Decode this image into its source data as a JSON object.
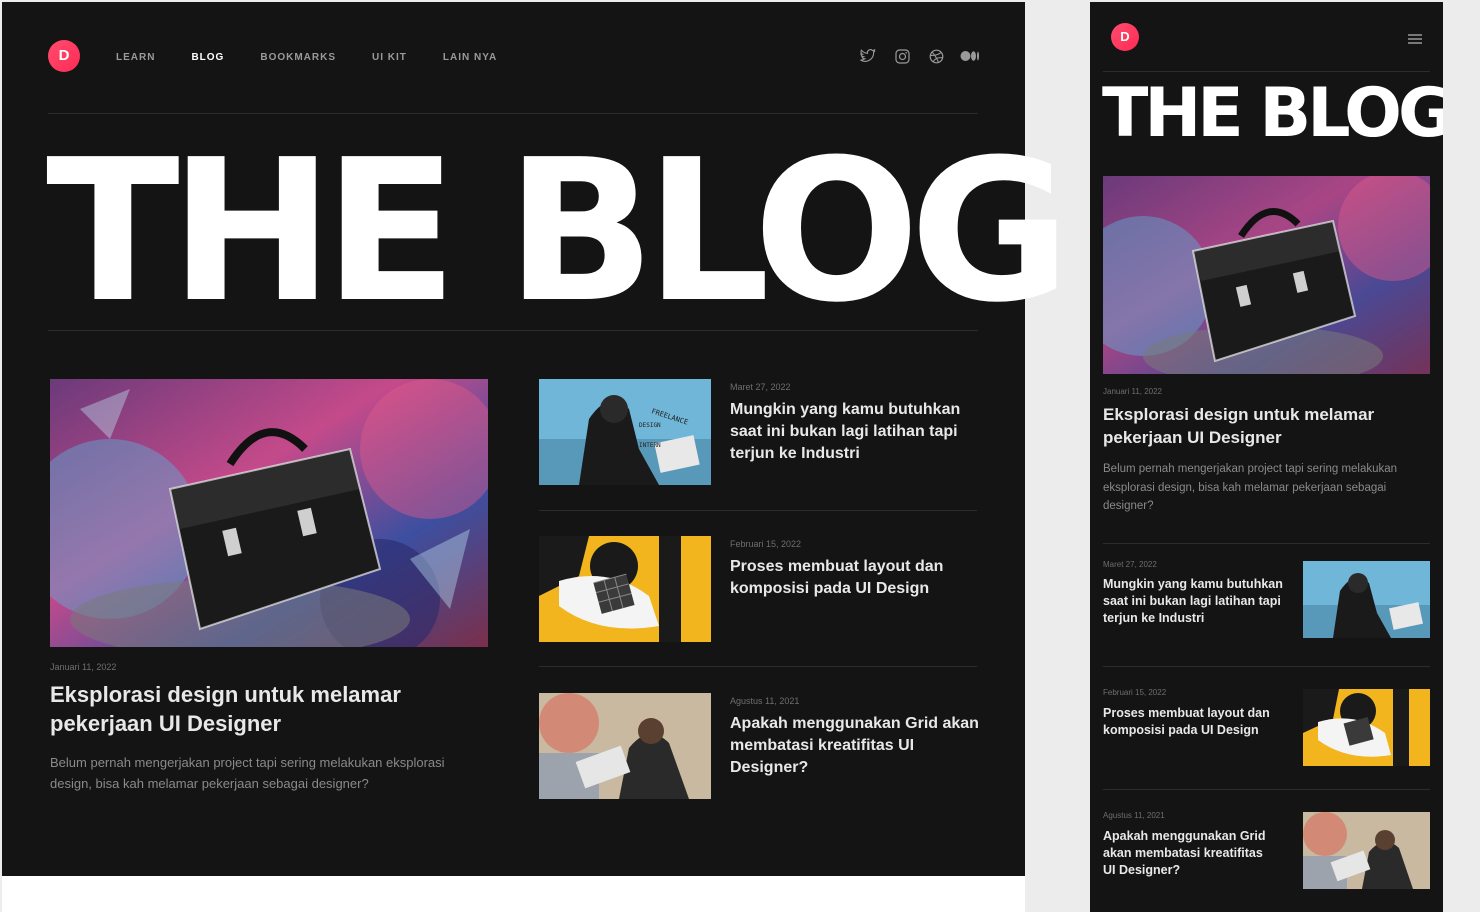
{
  "brand": {
    "logo_letter": "D",
    "accent": "#ff2a55"
  },
  "nav": {
    "items": [
      {
        "label": "LEARN",
        "active": false
      },
      {
        "label": "BLOG",
        "active": true
      },
      {
        "label": "BOOKMARKS",
        "active": false
      },
      {
        "label": "UI KIT",
        "active": false
      },
      {
        "label": "LAIN NYA",
        "active": false
      }
    ]
  },
  "social": [
    "twitter-icon",
    "instagram-icon",
    "dribbble-icon",
    "medium-icon"
  ],
  "hero": {
    "title": "THE BLOG"
  },
  "featured": {
    "date": "Januari 11, 2022",
    "title": "Eksplorasi design untuk melamar pekerjaan UI Designer",
    "excerpt": "Belum pernah mengerjakan project tapi sering melakukan eksplorasi design, bisa kah melamar pekerjaan sebagai designer?"
  },
  "posts": [
    {
      "date": "Maret 27, 2022",
      "title": "Mungkin yang kamu butuhkan saat ini bukan lagi latihan tapi terjun ke Industri"
    },
    {
      "date": "Februari 15, 2022",
      "title": "Proses membuat layout dan komposisi pada UI Design"
    },
    {
      "date": "Agustus 11, 2021",
      "title": "Apakah menggunakan Grid akan membatasi kreatifitas UI Designer?"
    }
  ],
  "colors": {
    "bg": "#141414",
    "text": "#e8e8e8",
    "muted": "#8a8a8a",
    "date": "#6e6e6e",
    "yellow": "#f2b51e"
  }
}
